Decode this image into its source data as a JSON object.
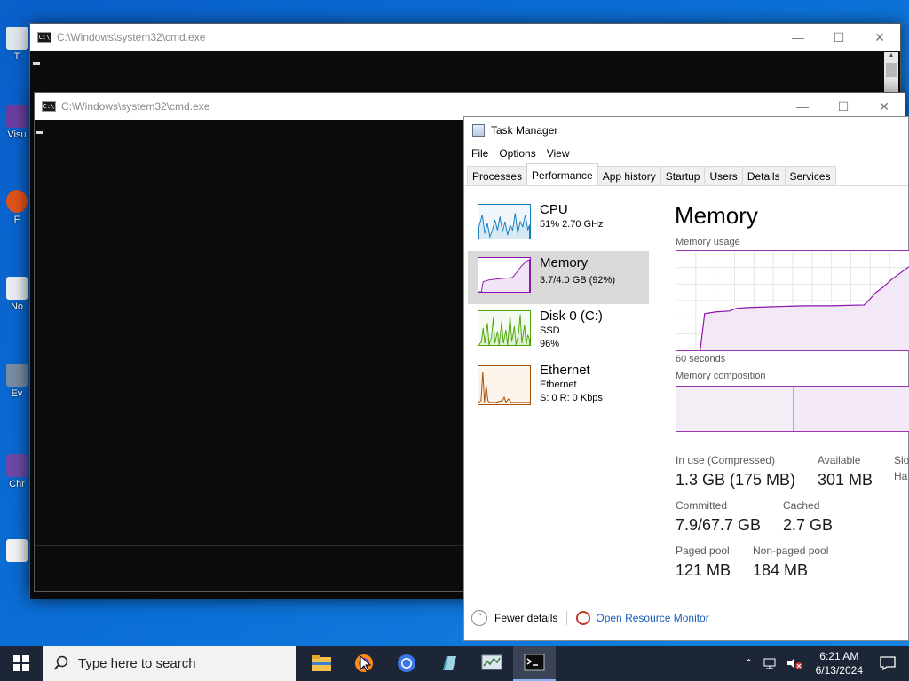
{
  "cmd_back": {
    "title": "C:\\Windows\\system32\\cmd.exe"
  },
  "cmd_front": {
    "title": "C:\\Windows\\system32\\cmd.exe"
  },
  "desktop_icons": [
    {
      "label": "T"
    },
    {
      "label": "Visu"
    },
    {
      "label": "F"
    },
    {
      "label": "No"
    },
    {
      "label": "Ev"
    },
    {
      "label": "Chr"
    }
  ],
  "taskmgr": {
    "title": "Task Manager",
    "menu": [
      "File",
      "Options",
      "View"
    ],
    "tabs": [
      "Processes",
      "Performance",
      "App history",
      "Startup",
      "Users",
      "Details",
      "Services"
    ],
    "resources": [
      {
        "name": "CPU",
        "line1": "51%  2.70 GHz",
        "line2": ""
      },
      {
        "name": "Memory",
        "line1": "3.7/4.0 GB (92%)",
        "line2": ""
      },
      {
        "name": "Disk 0 (C:)",
        "line1": "SSD",
        "line2": "96%"
      },
      {
        "name": "Ethernet",
        "line1": "Ethernet",
        "line2": "S: 0  R: 0 Kbps"
      }
    ],
    "memory": {
      "title": "Memory",
      "usage_label": "Memory usage",
      "time_label": "60 seconds",
      "composition_label": "Memory composition",
      "in_use_label": "In use (Compressed)",
      "in_use_value": "1.3 GB (175 MB)",
      "available_label": "Available",
      "available_value": "301 MB",
      "slots_label": "Slo",
      "slots_value": "Ha",
      "committed_label": "Committed",
      "committed_value": "7.9/67.7 GB",
      "cached_label": "Cached",
      "cached_value": "2.7 GB",
      "paged_label": "Paged pool",
      "paged_value": "121 MB",
      "nonpaged_label": "Non-paged pool",
      "nonpaged_value": "184 MB"
    },
    "footer": {
      "fewer": "Fewer details",
      "monitor": "Open Resource Monitor"
    }
  },
  "taskbar": {
    "search_placeholder": "Type here to search",
    "time": "6:21 AM",
    "date": "6/13/2024"
  },
  "colors": {
    "cpu": "#117dbb",
    "memory": "#8b12ae",
    "disk": "#4da60c",
    "ethernet": "#a74f01"
  }
}
